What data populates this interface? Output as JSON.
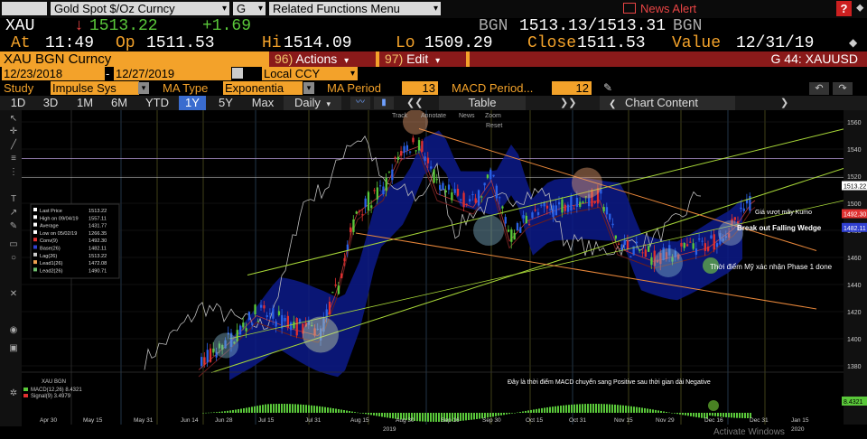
{
  "toolbar": {
    "ticker_select": "Gold Spot $/Oz Curncy",
    "g_select": "G",
    "related_menu": "Related Functions Menu",
    "news_alert": "News Alert"
  },
  "quote": {
    "symbol": "XAU",
    "arrow": "↓",
    "last": "1513.22",
    "change": "+1.69",
    "source": "BGN",
    "bid_ask": "1513.13/1513.31",
    "source2": "BGN",
    "at_label": "At",
    "at_time": "11:49",
    "op_label": "Op",
    "op_value": "1511.53",
    "hi_label": "Hi",
    "hi_value": "1514.09",
    "lo_label": "Lo",
    "lo_value": "1509.29",
    "close_label": "Close",
    "close_value": "1511.53",
    "value_label": "Value",
    "value_date": "12/31/19"
  },
  "security": {
    "name": "XAU BGN Curncy",
    "actions_num": "96)",
    "actions_label": "Actions",
    "edit_num": "97)",
    "edit_label": "Edit",
    "gcode": "G 44: XAUUSD"
  },
  "dates": {
    "start": "12/23/2018",
    "end": "12/27/2019",
    "ccy": "Local CCY"
  },
  "study": {
    "study_label": "Study",
    "study_value": "Impulse Sys",
    "ma_type_label": "MA Type",
    "ma_type_value": "Exponentia",
    "ma_period_label": "MA Period",
    "ma_period_value": "13",
    "macd_label": "MACD Period...",
    "macd_value": "12"
  },
  "tabs": {
    "d1": "1D",
    "d3": "3D",
    "m1": "1M",
    "m6": "6M",
    "ytd": "YTD",
    "y1": "1Y",
    "y5": "5Y",
    "max": "Max",
    "period": "Daily",
    "table": "Table",
    "chart_content": "Chart Content"
  },
  "mini_toolbar": {
    "track": "Track",
    "annotate": "Annotate",
    "news": "News",
    "zoom": "Zoom",
    "reset": "Reset"
  },
  "legend": [
    {
      "label": "Last Price",
      "value": "1513.22",
      "color": "#ffffff"
    },
    {
      "label": "High on 09/04/19",
      "value": "1557.11",
      "color": "#ffffff"
    },
    {
      "label": "Average",
      "value": "1431.77",
      "color": "#ffffff"
    },
    {
      "label": "Low on 05/02/19",
      "value": "1266.35",
      "color": "#ffffff"
    },
    {
      "label": "Conv(9)",
      "value": "1492.30",
      "color": "#e03030"
    },
    {
      "label": "Base(26)",
      "value": "1482.11",
      "color": "#3040d0"
    },
    {
      "label": "Lag(26)",
      "value": "1513.22",
      "color": "#cccccc"
    },
    {
      "label": "Lead1(26)",
      "value": "1472.08",
      "color": "#f0a050"
    },
    {
      "label": "Lead2(26)",
      "value": "1490.71",
      "color": "#70c070"
    }
  ],
  "annotations": {
    "kumo": "Giá vượt mây Kumo",
    "breakout": "Break out Falling Wedge",
    "phase1": "Thời điểm Mỹ xác nhận Phase 1 done",
    "macd_note": "Đây là thời điểm MACD chuyển sang Positive sau thời gian dài Negative"
  },
  "price_axis": {
    "ticks": [
      "1560",
      "1540",
      "1520",
      "1500",
      "1480",
      "1460",
      "1440",
      "1420",
      "1400",
      "1380"
    ],
    "last_tag": "1513.22",
    "tag2": "1492.30",
    "tag3": "1482.11"
  },
  "macd_panel": {
    "title": "XAU BGN",
    "macd_label": "MACD(12,26) 8.4321",
    "signal_label": "Signal(9)   3.4979",
    "tag": "8.4321"
  },
  "x_axis": {
    "labels": [
      "Apr 30",
      "May 15",
      "May 31",
      "Jun 14",
      "Jun 28",
      "Jul 15",
      "Jul 31",
      "Aug 15",
      "Aug 30",
      "Sep 16",
      "Sep 30",
      "Oct 15",
      "Oct 31",
      "Nov 15",
      "Nov 29",
      "Dec 16",
      "Dec 31",
      "Jan 15"
    ],
    "year1": "2019",
    "year2": "2020"
  },
  "watermark": "Activate Windows",
  "colors": {
    "amber": "#f3a22a",
    "up": "#5ac83a",
    "down": "#e03030",
    "blue": "#2a62e8",
    "kumo": "#0c1a8a",
    "red_pill": "#8a1a1a"
  }
}
